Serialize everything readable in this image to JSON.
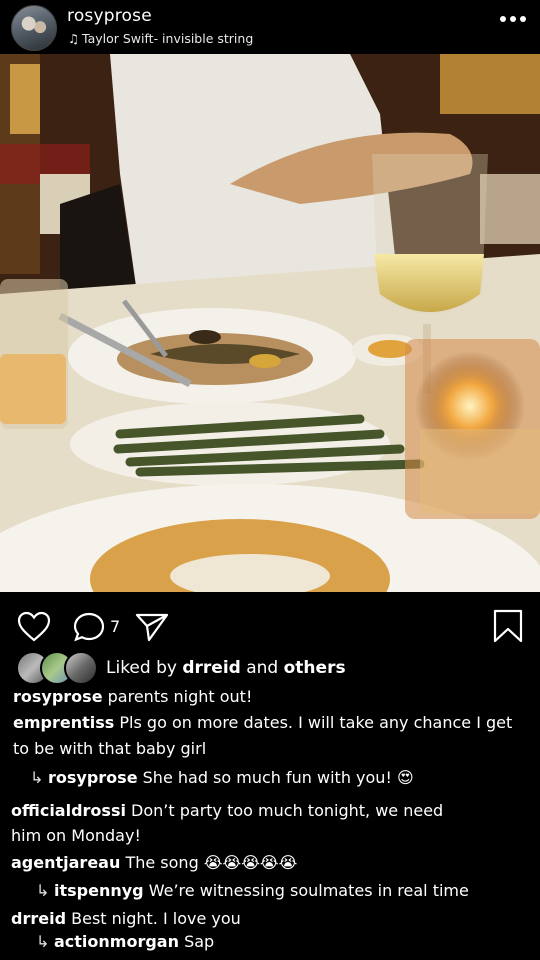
{
  "header": {
    "username": "rosyprose",
    "song": "Taylor Swift- invisible string",
    "note_icon": "♫",
    "more_icon": "more-horizontal-icon"
  },
  "post": {
    "comment_count": "7",
    "liked_by_prefix": "Liked by",
    "liked_by_user": "drreid",
    "liked_by_and": "and",
    "liked_by_others": "others"
  },
  "comments": [
    {
      "user": "rosyprose",
      "text": "parents night out!",
      "reply": false
    },
    {
      "user": "emprentiss",
      "text": "Pls go on more dates. I will take any chance I get",
      "text2": "to be with that baby girl",
      "reply": false
    },
    {
      "user": "rosyprose",
      "text": "She had so much fun with you! 😍",
      "reply": true
    },
    {
      "user": "officialdrossi",
      "text": "Don’t party too much tonight, we need",
      "text2": "him on Monday!",
      "reply": false
    },
    {
      "user": "agentjareau",
      "text": "The song 😭😭😭😭😭",
      "reply": false
    },
    {
      "user": "itspennyg",
      "text": "We’re witnessing soulmates in real time",
      "reply": true
    },
    {
      "user": "drreid",
      "text": "Best night. I love you",
      "reply": false
    },
    {
      "user": "actionmorgan",
      "text": "Sap",
      "reply": true
    }
  ],
  "colors": {
    "background": "#000000",
    "text": "#ffffff"
  }
}
